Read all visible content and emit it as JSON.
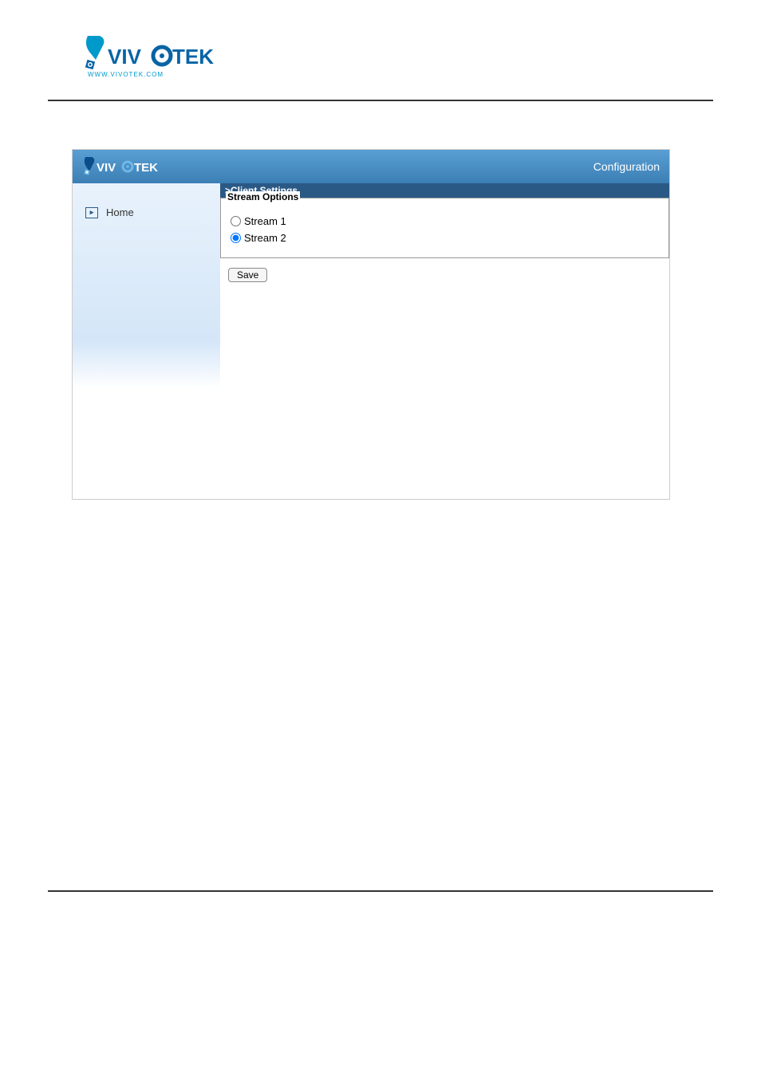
{
  "header": {
    "config_label": "Configuration"
  },
  "sidebar": {
    "items": [
      {
        "label": "Home"
      }
    ]
  },
  "content": {
    "title": ">Client Settings",
    "fieldset_label": "Stream Options",
    "options": [
      {
        "label": "Stream 1",
        "checked": false
      },
      {
        "label": "Stream 2",
        "checked": true
      }
    ],
    "save_label": "Save"
  }
}
